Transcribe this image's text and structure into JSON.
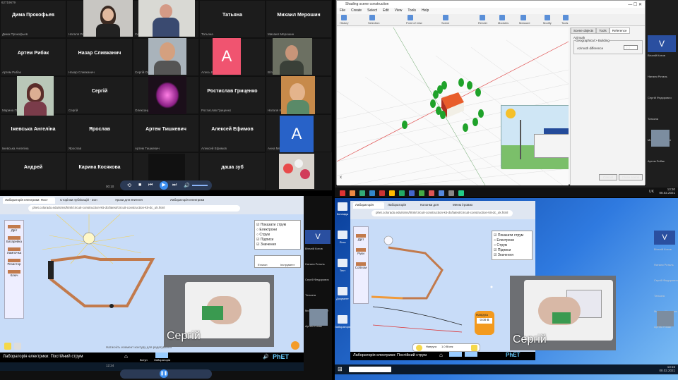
{
  "q1": {
    "meeting_id": "62719679",
    "tiles": [
      {
        "name": "Дима Прокофьев",
        "sub": "Дима Прокофьев"
      },
      {
        "name": "",
        "sub": "Наталя Роталь"
      },
      {
        "name": "",
        "sub": "Сергій Федорович Цвиль"
      },
      {
        "name": "Татьяна",
        "sub": "Татьяна"
      },
      {
        "name": "Михаил Мерошин",
        "sub": "Михаил Мерошин"
      },
      {
        "name": "Артем Рибак",
        "sub": "Артем Рибак"
      },
      {
        "name": "Назар Сливканич",
        "sub": "Назар Сливканич"
      },
      {
        "name": "",
        "sub": "Сергій Олександрович Серенко"
      },
      {
        "name": "",
        "sub": "Алесь Бнислав"
      },
      {
        "name": "",
        "sub": "Віталій Котов"
      },
      {
        "name": "",
        "sub": "Марина Пугаєва"
      },
      {
        "name": "Сергій",
        "sub": "Сергій"
      },
      {
        "name": "",
        "sub": "Олександр Куприянов"
      },
      {
        "name": "Ростислав Гриценко",
        "sub": "Ростислав Гриценко"
      },
      {
        "name": "",
        "sub": "Наталя Кудин"
      },
      {
        "name": "Іжевська Ангеліна",
        "sub": "Іжевська Ангеліна"
      },
      {
        "name": "Ярослав",
        "sub": "Ярослав"
      },
      {
        "name": "Артем Тишкевич",
        "sub": "Артем Тишкевич"
      },
      {
        "name": "Алексей Ефимов",
        "sub": "Алексей Ефимов"
      },
      {
        "name": "",
        "sub": "Анна Мельникова"
      },
      {
        "name": "Андрей",
        "sub": ""
      },
      {
        "name": "Карина Косякова",
        "sub": ""
      },
      {
        "name": "",
        "sub": ""
      },
      {
        "name": "даша зуб",
        "sub": ""
      }
    ],
    "avatar_letter": "A",
    "time": "00:10"
  },
  "q2": {
    "window_title": "Shading scene construction",
    "menu": [
      "File",
      "Create",
      "Select",
      "Edit",
      "View",
      "Tools",
      "Help"
    ],
    "tool_groups": [
      "History",
      "Selection",
      "Point of view",
      "Scene",
      "Render",
      "Modules",
      "Measure",
      "Modify",
      "Tools"
    ],
    "panel_tabs": [
      "Scene objects",
      "Tools",
      "Reference"
    ],
    "tree_root": "Azimuth",
    "group_label": "Geographical > Building",
    "field_label": "Azimuth difference",
    "field_value": "0.0",
    "cancel_label": "Cancel",
    "close_label": "Close scene",
    "people": [
      "Віталій Котов",
      "Наталя Роталь",
      "Сергій Федорович",
      "Татьяна",
      "Михаил Мерошин",
      "Артем Рибак"
    ],
    "side_letter": "V",
    "clock": "13:30",
    "date": "08.02.2021",
    "lang": "UK"
  },
  "q3": {
    "tabs": [
      "Лабораторія електрики: Пост",
      "Сторінки публікацій - Зон",
      "Уроки для вчителя",
      "Лабораторія електрики"
    ],
    "url": "phet.colorado.edu/sims/html/circuit-construction-kit-dc/latest/circuit-construction-kit-dc_uk.html",
    "toolbox": [
      "Дріт",
      "Батарейка",
      "Лампочка",
      "Резистор",
      "Ключ"
    ],
    "options": [
      "Показати струм",
      "Електрони",
      "Струм",
      "Підписи",
      "Значення"
    ],
    "presets": [
      "Еталон",
      "Інструмент"
    ],
    "hint": "Натисніть елемент контуру для редагування",
    "footer_title": "Лабораторія електрики: Постійний струм",
    "footer_tabs": [
      "Вступ",
      "Лабораторія"
    ],
    "cam_name": "Сергій",
    "side_letter": "V",
    "people": [
      "Віталій Котов",
      "Наталя Роталь",
      "Сергій Федорович",
      "Татьяна",
      "Михаил Мерошин",
      "Артем Рибак"
    ],
    "time": "12:24"
  },
  "q4": {
    "tabs": [
      "Лабораторія",
      "Лабораторія",
      "Колонки для",
      "Меню ігрових"
    ],
    "url": "phet.colorado.edu/sims/html/circuit-construction-kit-dc/latest/circuit-construction-kit-dc_uk.html",
    "toolbox": [
      "Дріт",
      "Руки",
      "Соблом"
    ],
    "options": [
      "Показати струм",
      "Електрони",
      "Струм",
      "Підписи",
      "Значення"
    ],
    "meter_label": "Напруга",
    "meter_value": "0.00 В",
    "speed_label": "Напруга",
    "speed_value": "1.0 В/сек",
    "footer_title": "Лабораторія електрики: Постійний струм",
    "footer_tabs": [
      "Вступ",
      "Лабораторія"
    ],
    "cam_name": "Сергій",
    "desktop_icons": [
      "Колладж",
      "Яхта",
      "Тест",
      "Документ",
      "Лабораторія"
    ],
    "side_letter": "V",
    "people": [
      "Віталій Котов",
      "Наталя Роталь",
      "Сергій Федорович",
      "Татьяна",
      "Михаил Мерошин",
      "Артем Рибак"
    ],
    "clock": "13:15",
    "date": "08.02.2021"
  },
  "colors": {
    "phet_bg": "#c8dcf8",
    "zoom_blue": "#2b4fa5",
    "avatar_red": "#f05470",
    "avatar_blue": "#2862c8",
    "win_blue": "#1c57b8"
  }
}
